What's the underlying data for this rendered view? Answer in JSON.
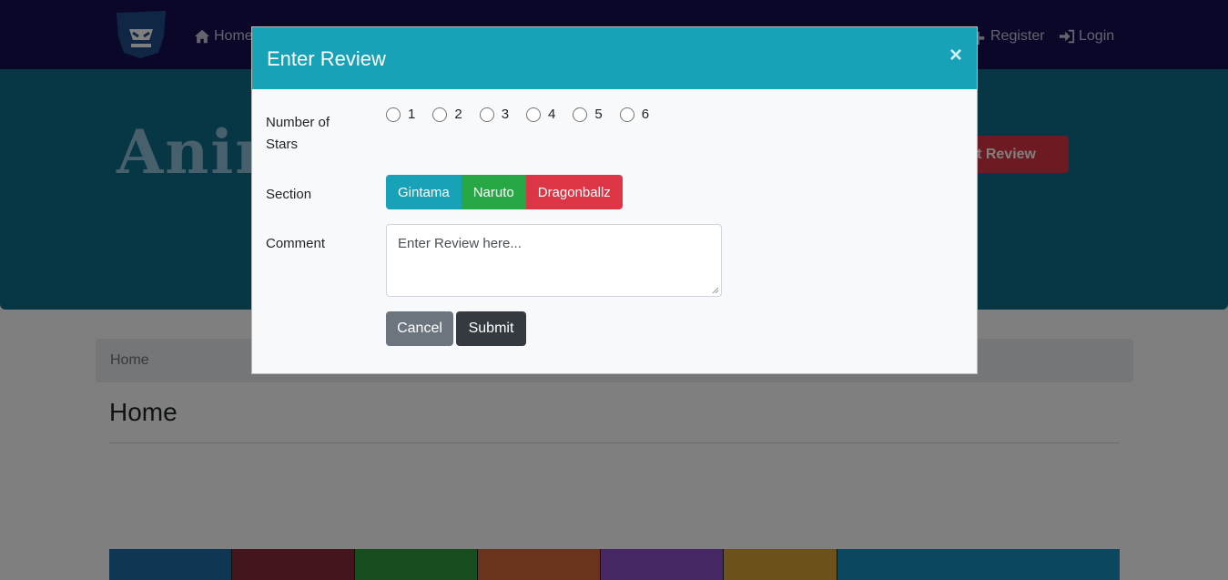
{
  "navbar": {
    "home_label": "Home",
    "register_label": "Register",
    "login_label": "Login"
  },
  "jumbotron": {
    "title": "Anim",
    "post_review_label": "Post Review"
  },
  "breadcrumb": {
    "current": "Home"
  },
  "page": {
    "heading": "Home"
  },
  "banner": {
    "tiles": [
      {
        "color": "#1f6fa8"
      },
      {
        "color": "#8a2a3a"
      },
      {
        "color": "#2f9a3c"
      },
      {
        "color": "#d2663a"
      },
      {
        "color": "#8a4ec8"
      },
      {
        "color": "#d8a33a"
      },
      {
        "color": "#1a8fbf"
      }
    ]
  },
  "modal": {
    "title": "Enter Review",
    "close_symbol": "×",
    "stars_label": "Number of Stars",
    "star_options": [
      "1",
      "2",
      "3",
      "4",
      "5",
      "6"
    ],
    "section_label": "Section",
    "sections": [
      "Gintama",
      "Naruto",
      "Dragonballz"
    ],
    "comment_label": "Comment",
    "comment_placeholder": "Enter Review here...",
    "cancel_label": "Cancel",
    "submit_label": "Submit"
  },
  "colors": {
    "navbar": "#160f52",
    "jumbotron": "#0e6c8a",
    "modal_header": "#17a2b8",
    "gintama": "#17a2b8",
    "naruto": "#28a745",
    "dragonballz": "#dc3545",
    "cancel": "#6c757d",
    "submit": "#343a40"
  }
}
